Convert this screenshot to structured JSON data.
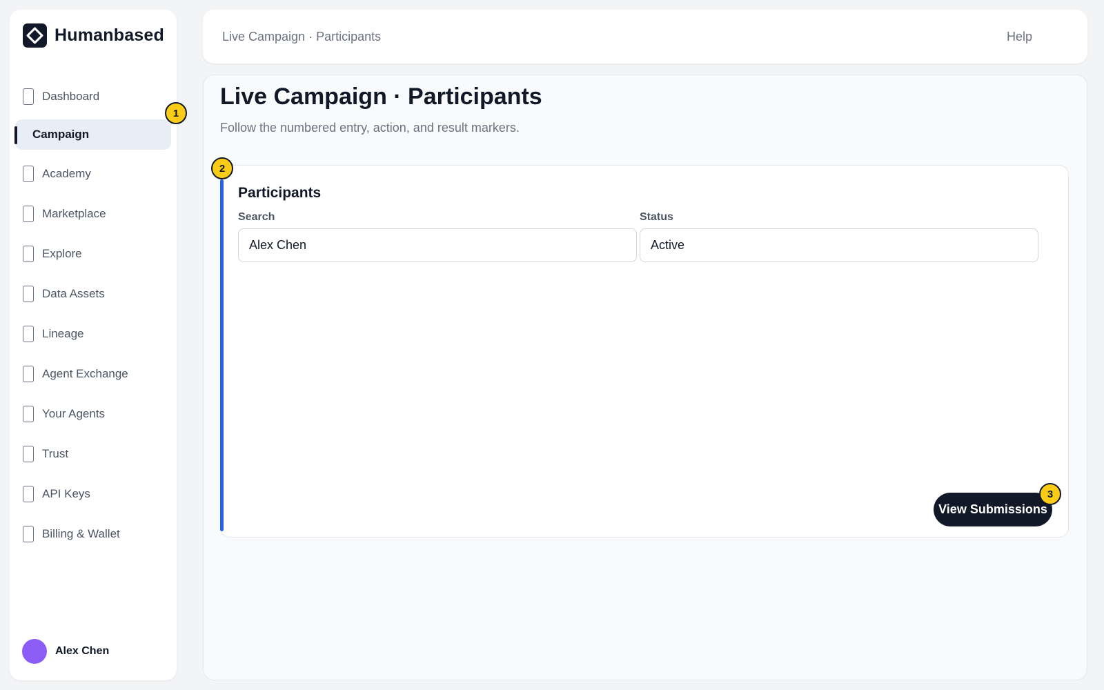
{
  "app": {
    "brand": "Humanbased",
    "logo_icon": "diamond-logo-icon"
  },
  "sidebar": {
    "items": [
      {
        "label": "Dashboard",
        "icon": "page-icon",
        "active": false
      },
      {
        "label": "Campaign",
        "icon": "page-icon",
        "active": true
      },
      {
        "label": "Academy",
        "icon": "page-icon",
        "active": false
      },
      {
        "label": "Marketplace",
        "icon": "page-icon",
        "active": false
      },
      {
        "label": "Explore",
        "icon": "page-icon",
        "active": false
      },
      {
        "label": "Data Assets",
        "icon": "page-icon",
        "active": false
      },
      {
        "label": "Lineage",
        "icon": "page-icon",
        "active": false
      },
      {
        "label": "Agent Exchange",
        "icon": "page-icon",
        "active": false
      },
      {
        "label": "Your Agents",
        "icon": "page-icon",
        "active": false
      },
      {
        "label": "Trust",
        "icon": "page-icon",
        "active": false
      },
      {
        "label": "API Keys",
        "icon": "page-icon",
        "active": false
      },
      {
        "label": "Billing & Wallet",
        "icon": "page-icon",
        "active": false
      }
    ],
    "user": {
      "name": "Alex Chen",
      "avatar_color": "#8b5cf6"
    }
  },
  "header": {
    "breadcrumb": "Live Campaign · Participants",
    "help_label": "Help"
  },
  "main": {
    "title": "Live Campaign · Participants",
    "subtitle": "Follow the numbered entry, action, and result markers.",
    "card": {
      "title": "Participants",
      "search_label": "Search",
      "search_value": "Alex Chen",
      "status_label": "Status",
      "status_value": "Active",
      "action_button": "View Submissions"
    }
  },
  "markers": {
    "entry": "1",
    "action": "2",
    "result": "3",
    "color": "#facc15"
  },
  "colors": {
    "accent": "#2563eb",
    "dark": "#111827"
  }
}
